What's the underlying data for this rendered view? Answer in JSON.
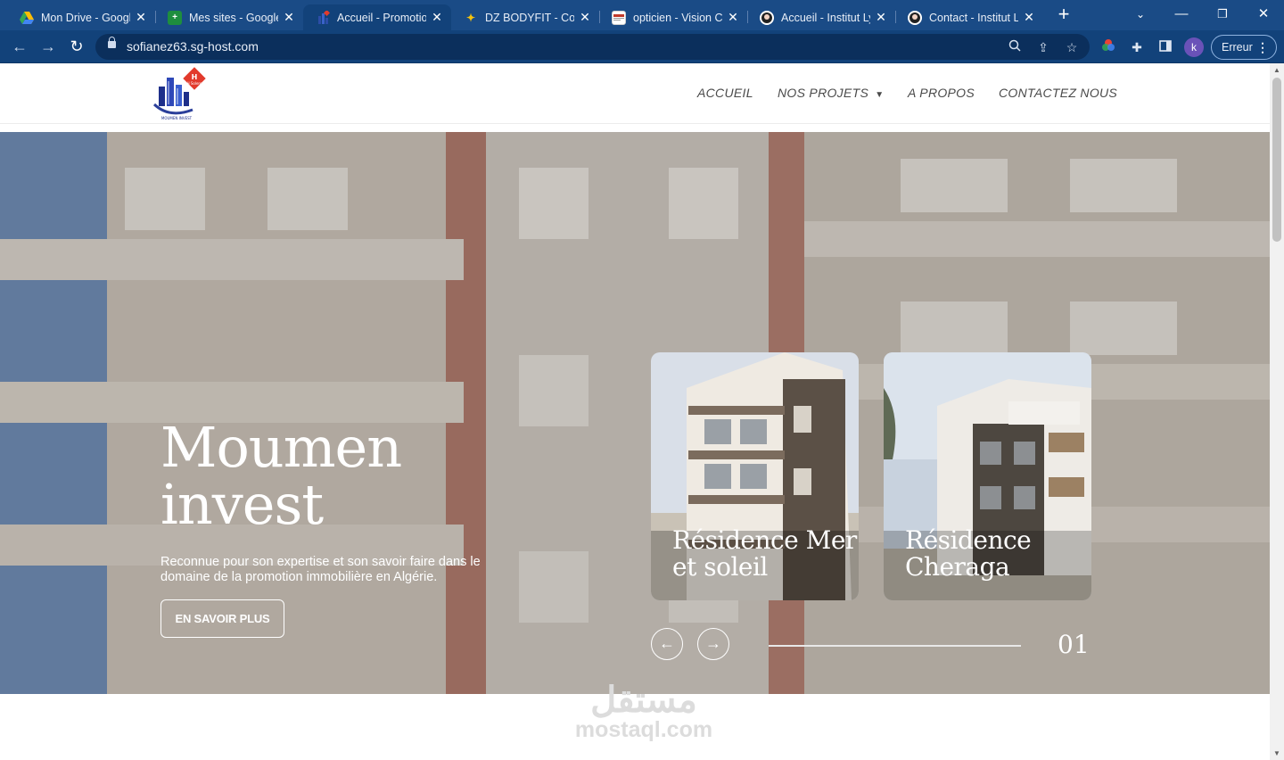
{
  "browser": {
    "tabs": [
      {
        "title": "Mon Drive - Google Drive",
        "icon": "google-drive-icon",
        "active": false
      },
      {
        "title": "Mes sites - Google Sites",
        "icon": "google-sites-icon",
        "active": false
      },
      {
        "title": "Accueil - Promotion immobilière",
        "icon": "moumen-invest-icon",
        "active": true
      },
      {
        "title": "DZ BODYFIT - Coming soon",
        "icon": "bodyfit-icon",
        "active": false
      },
      {
        "title": "opticien - Vision Care",
        "icon": "opticien-icon",
        "active": false
      },
      {
        "title": "Accueil - Institut Lyna",
        "icon": "institut-icon",
        "active": false
      },
      {
        "title": "Contact - Institut Lyna",
        "icon": "institut-icon",
        "active": false
      }
    ],
    "url": "sofianez63.sg-host.com",
    "profile_initial": "k",
    "error_label": "Erreur"
  },
  "site": {
    "logo_badge_letter": "H",
    "logo_badge_text": "H Solere",
    "logo_caption": "MOUMEN INVEST",
    "nav": [
      {
        "label": "ACCUEIL"
      },
      {
        "label": "NOS PROJETS"
      },
      {
        "label": "A PROPOS"
      },
      {
        "label": "CONTACTEZ NOUS"
      }
    ]
  },
  "hero": {
    "title_line1": "Moumen",
    "title_line2": "invest",
    "subtitle": "Reconnue pour son expertise et son savoir faire dans le domaine de la promotion immobilière en Algérie.",
    "button_label": "EN SAVOIR PLUS",
    "cards": [
      {
        "title": "Résidence Mer et soleil"
      },
      {
        "title": "Résidence Cheraga"
      }
    ],
    "slide_number": "01"
  },
  "watermark": {
    "arabic": "مستقل",
    "latin": "mostaql.com"
  }
}
